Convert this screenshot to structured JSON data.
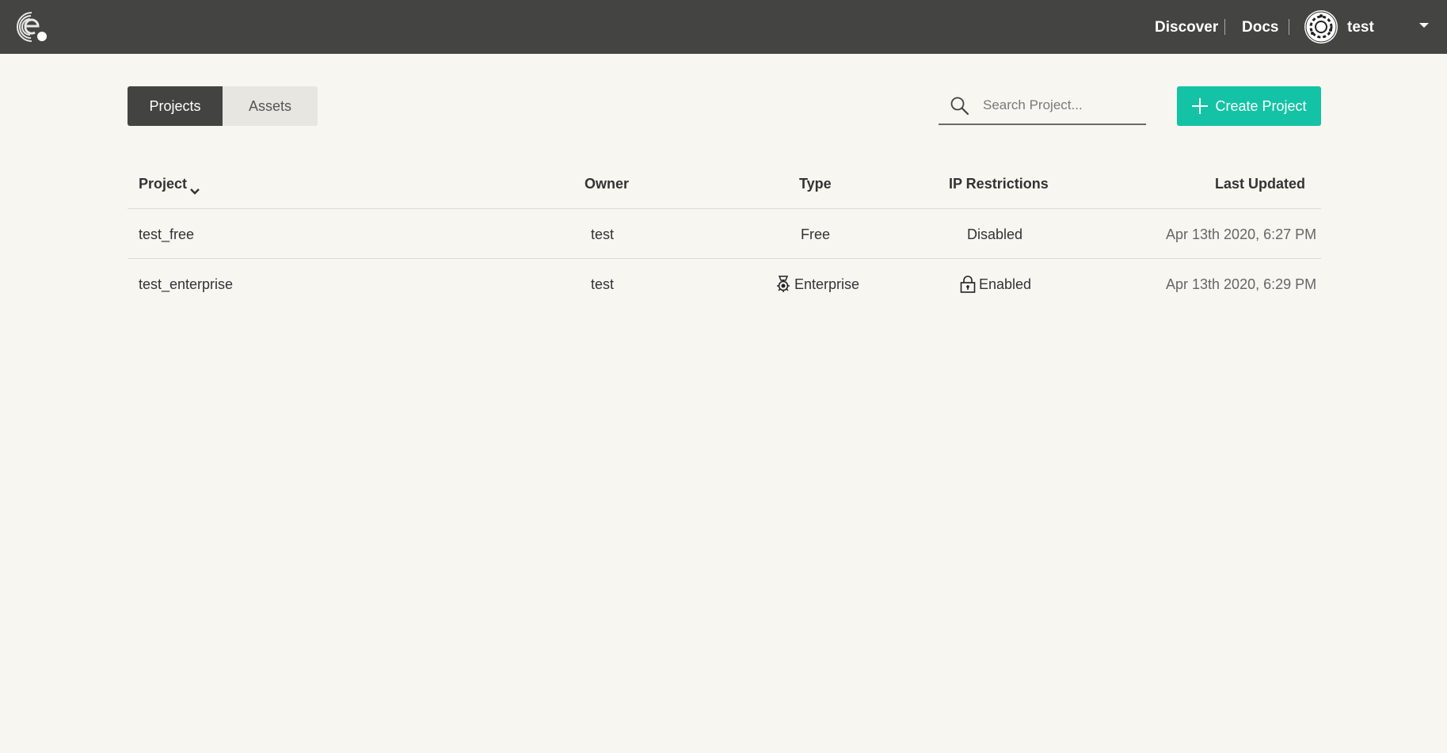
{
  "topbar": {
    "logo_icon": "e-logo-icon",
    "discover_label": "Discover",
    "docs_label": "Docs",
    "avatar_icon": "avatar-icon",
    "user_name": "test",
    "user_menu_icon": "caret-down-icon",
    "background_color": "#444442"
  },
  "tabs": [
    {
      "label": "Projects",
      "active": true
    },
    {
      "label": "Assets",
      "active": false
    }
  ],
  "search": {
    "placeholder": "Search Project...",
    "value": "",
    "icon": "search-icon"
  },
  "create_button": {
    "label": "Create Project",
    "icon": "plus-icon",
    "color": "#14c3a6"
  },
  "table": {
    "columns": [
      {
        "label": "Project",
        "sort_icon": "chevron-down-icon"
      },
      {
        "label": "Owner"
      },
      {
        "label": "Type"
      },
      {
        "label": "IP Restrictions"
      },
      {
        "label": "Last Updated"
      }
    ],
    "rows": [
      {
        "project": "test_free",
        "owner": "test",
        "type": "Free",
        "type_icon": null,
        "ip_restrictions": "Disabled",
        "ip_icon": null,
        "last_updated": "Apr 13th 2020, 6:27 PM"
      },
      {
        "project": "test_enterprise",
        "owner": "test",
        "type": "Enterprise",
        "type_icon": "enterprise-badge-icon",
        "ip_restrictions": "Enabled",
        "ip_icon": "lock-icon",
        "last_updated": "Apr 13th 2020, 6:29 PM"
      }
    ]
  }
}
